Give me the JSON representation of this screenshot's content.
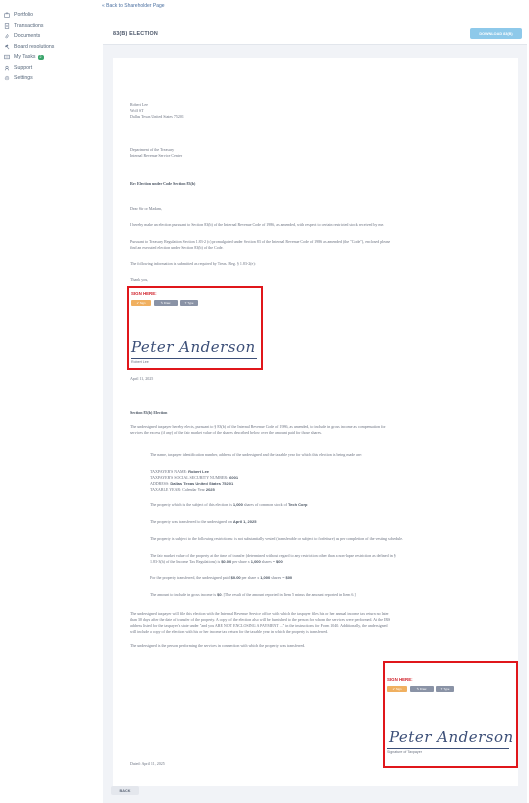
{
  "nav": {
    "back_link": "Back to Shareholder Page",
    "items": [
      {
        "label": "Portfolio",
        "icon": "briefcase-icon"
      },
      {
        "label": "Transactions",
        "icon": "document-icon"
      },
      {
        "label": "Documents",
        "icon": "paperclip-icon"
      },
      {
        "label": "Board resolutions",
        "icon": "gavel-icon"
      },
      {
        "label": "My Tasks",
        "icon": "tasks-icon",
        "badge": "2"
      },
      {
        "label": "Support",
        "icon": "support-icon"
      },
      {
        "label": "Settings",
        "icon": "gear-icon"
      }
    ]
  },
  "header": {
    "title": "83(B) ELECTION",
    "download_label": "DOWNLOAD 83(B)"
  },
  "doc": {
    "sender_name": "Robert Lee",
    "sender_address1": "Wolf ST",
    "sender_address2": "Dallas Texas United States 75201",
    "dept1": "Department of the Treasury",
    "dept2": "Internal Revenue Service Center",
    "re_line": "Re: Election under Code Section 83(b)",
    "salutation": "Dear Sir or Madam,",
    "para1": "I hereby make an election pursuant to Section 83(b) of the Internal Revenue Code of 1986, as amended, with respect to certain restricted stock received by me.",
    "para2a": "Pursuant to Treasury Regulation Section 1.83-2 (c) promulgated under Section 83 of the Internal Revenue Code of 1986 as amended (the \"Code\"), enclosed please",
    "para2b": "find an executed election under Section 83(b) of the Code.",
    "para3": "The following information is submitted as required by Treas. Reg. § 1.83-2(e):",
    "thank_you": "Thank you,",
    "sign_here": "SIGN HERE:",
    "btn_sign": "Sign",
    "btn_draw": "Draw",
    "btn_type": "Type",
    "signature_name": "Peter Anderson",
    "sig1_caption": "Robert Lee",
    "date1": "April 11, 2025",
    "section_title": "Section 83(b) Election",
    "intro1": "The undersigned taxpayer hereby elects, pursuant to § 83(b) of the Internal Revenue Code of 1986, as amended, to include in gross income as compensation for",
    "intro2": "services the excess (if any) of the fair market value of the shares described below over the amount paid for those shares.",
    "item1": "The name, taxpayer identification number, address of the undersigned and the taxable year for which this election is being made are:",
    "tp_name_label": "TAXPAYER'S NAME:",
    "tp_name": "Robert Lee",
    "tp_ssn_label": "TAXPAYER'S SOCIAL SECURITY NUMBER:",
    "tp_ssn": "6001",
    "tp_addr_label": "ADDRESS:",
    "tp_addr": "Dallas Texas United States 75201",
    "tp_year_label": "TAXABLE YEAR: Calendar Year",
    "tp_year": "2025",
    "item2a": "The property which is the subject of this election is",
    "item2b": "1,000",
    "item2c": "shares of common stock of",
    "item2d": "Tech Corp",
    "item3a": "The property was transferred to the undersigned on",
    "item3b": "April 1, 2025",
    "item4": "The property is subject to the following restrictions: is not substantially vested (transferable or subject to forfeiture) as per completion of the vesting schedule.",
    "item5a": "The fair market value of the property at the time of transfer (determined without regard to any restriction other than a non-lapse restriction as defined in §",
    "item5b": "1.83-3(h) of the Income Tax Regulations) is",
    "item5c": "$0.00",
    "item5d": "per share x",
    "item5e": "1,000",
    "item5f": "shares =",
    "item5g": "$00",
    "item6a": "For the property transferred, the undersigned paid",
    "item6b": "$0.00",
    "item6c": "per share x",
    "item6d": "1,000",
    "item6e": "shares =",
    "item6f": "$00",
    "item7a": "The amount to include in gross income is",
    "item7b": "$0",
    "item7c": ". [The result of the amount reported in Item 5 minus the amount reported in Item 6.]",
    "close1": "The undersigned taxpayer will file this election with the Internal Revenue Service office with which the taxpayer files his or her annual income tax return no later",
    "close2": "than 30 days after the date of transfer of the property. A copy of the election also will be furnished to the person for whom the services were performed. At the IRS",
    "close3": "address listed for the taxpayer's state under \"and you ARE NOT ENCLOSING A PAYMENT ...\" in the instructions for Form 1040. Additionally, the undersigned",
    "close4": "will include a copy of the election with his or her income tax return for the taxable year in which the property is transferred.",
    "close5": "The undersigned is the person performing the services in connection with which the property was transferred.",
    "sig2_caption": "Signature of Taxpayer",
    "date2": "Dated: April 11, 2025"
  },
  "footer": {
    "back_label": "BACK"
  }
}
